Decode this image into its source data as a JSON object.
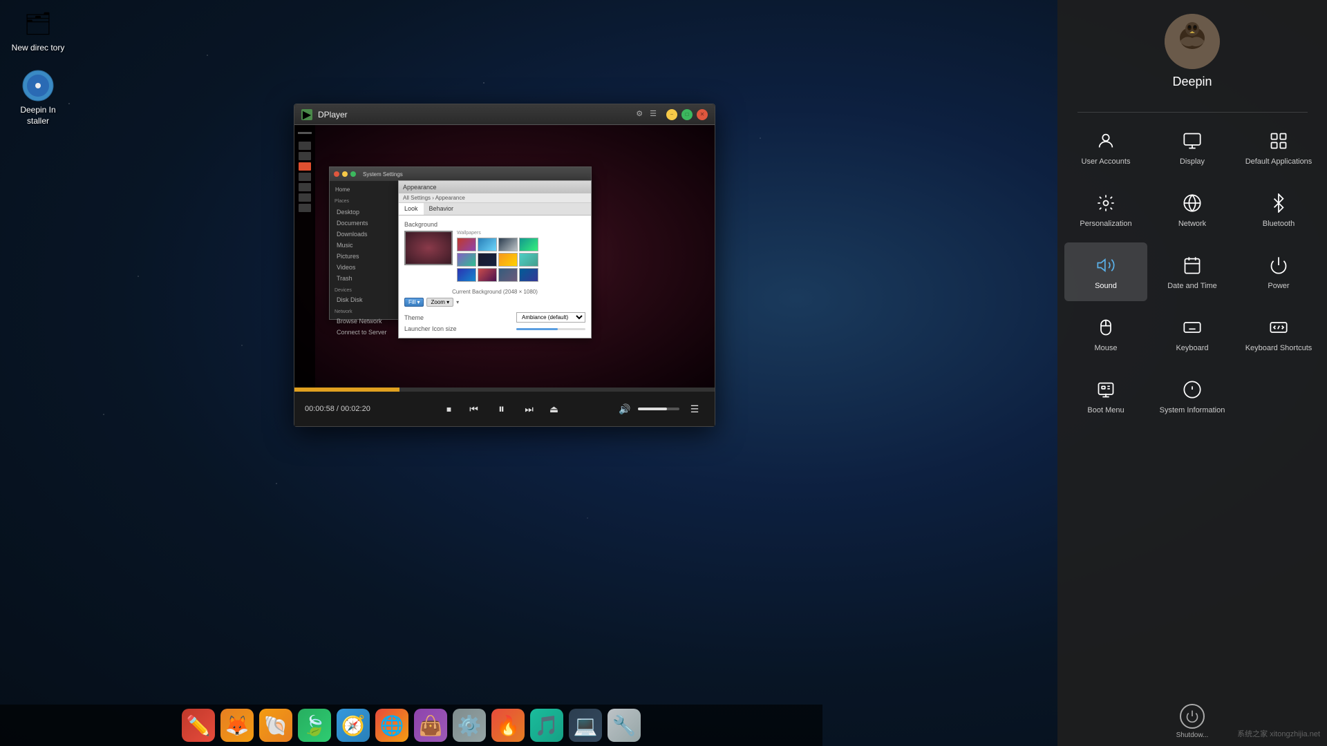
{
  "desktop": {
    "icons": [
      {
        "id": "folder",
        "label": "New direc tory",
        "emoji": "🗂"
      },
      {
        "id": "installer",
        "label": "Deepin In staller",
        "emoji": "💿"
      }
    ]
  },
  "rightPanel": {
    "username": "Deepin",
    "settingsItems": [
      {
        "id": "user-accounts",
        "label": "User Accounts",
        "icon": "user"
      },
      {
        "id": "display",
        "label": "Display",
        "icon": "display"
      },
      {
        "id": "default-applications",
        "label": "Default Applications",
        "icon": "apps"
      },
      {
        "id": "personalization",
        "label": "Personalization",
        "icon": "personalization"
      },
      {
        "id": "network",
        "label": "Network",
        "icon": "network"
      },
      {
        "id": "bluetooth",
        "label": "Bluetooth",
        "icon": "bluetooth"
      },
      {
        "id": "sound",
        "label": "Sound",
        "icon": "sound",
        "active": true
      },
      {
        "id": "date-time",
        "label": "Date and Time",
        "icon": "datetime"
      },
      {
        "id": "power",
        "label": "Power",
        "icon": "power"
      },
      {
        "id": "mouse",
        "label": "Mouse",
        "icon": "mouse"
      },
      {
        "id": "keyboard",
        "label": "Keyboard",
        "icon": "keyboard"
      },
      {
        "id": "keyboard-shortcuts",
        "label": "Keyboard Shortcuts",
        "icon": "shortcuts"
      },
      {
        "id": "boot-menu",
        "label": "Boot Menu",
        "icon": "boot"
      },
      {
        "id": "system-information",
        "label": "System Information",
        "icon": "info"
      }
    ],
    "shutdownLabel": "Shutdow..."
  },
  "dplayer": {
    "title": "DPlayer",
    "timeDisplay": "00:00:58 / 00:02:20",
    "progressPercent": 25,
    "volumePercent": 70
  },
  "taskbar": {
    "apps": [
      {
        "id": "pencil",
        "emoji": "✏️",
        "label": "Pencil"
      },
      {
        "id": "fox",
        "emoji": "🦊",
        "label": "Firefox"
      },
      {
        "id": "shell",
        "emoji": "🐚",
        "label": "Shell"
      },
      {
        "id": "leaf",
        "emoji": "🍃",
        "label": "Leaf"
      },
      {
        "id": "compass",
        "emoji": "🧭",
        "label": "Compass"
      },
      {
        "id": "chrome",
        "emoji": "🌐",
        "label": "Chrome"
      },
      {
        "id": "bag",
        "emoji": "👜",
        "label": "Bag"
      },
      {
        "id": "settings2",
        "emoji": "⚙️",
        "label": "Settings"
      },
      {
        "id": "firefox",
        "emoji": "🔥",
        "label": "Firefox2"
      },
      {
        "id": "music",
        "emoji": "🎵",
        "label": "Music"
      },
      {
        "id": "terminal",
        "emoji": "💻",
        "label": "Terminal"
      },
      {
        "id": "wrench",
        "emoji": "🔧",
        "label": "Wrench"
      }
    ]
  },
  "watermark": "系统之家 xitongzhijia.net"
}
